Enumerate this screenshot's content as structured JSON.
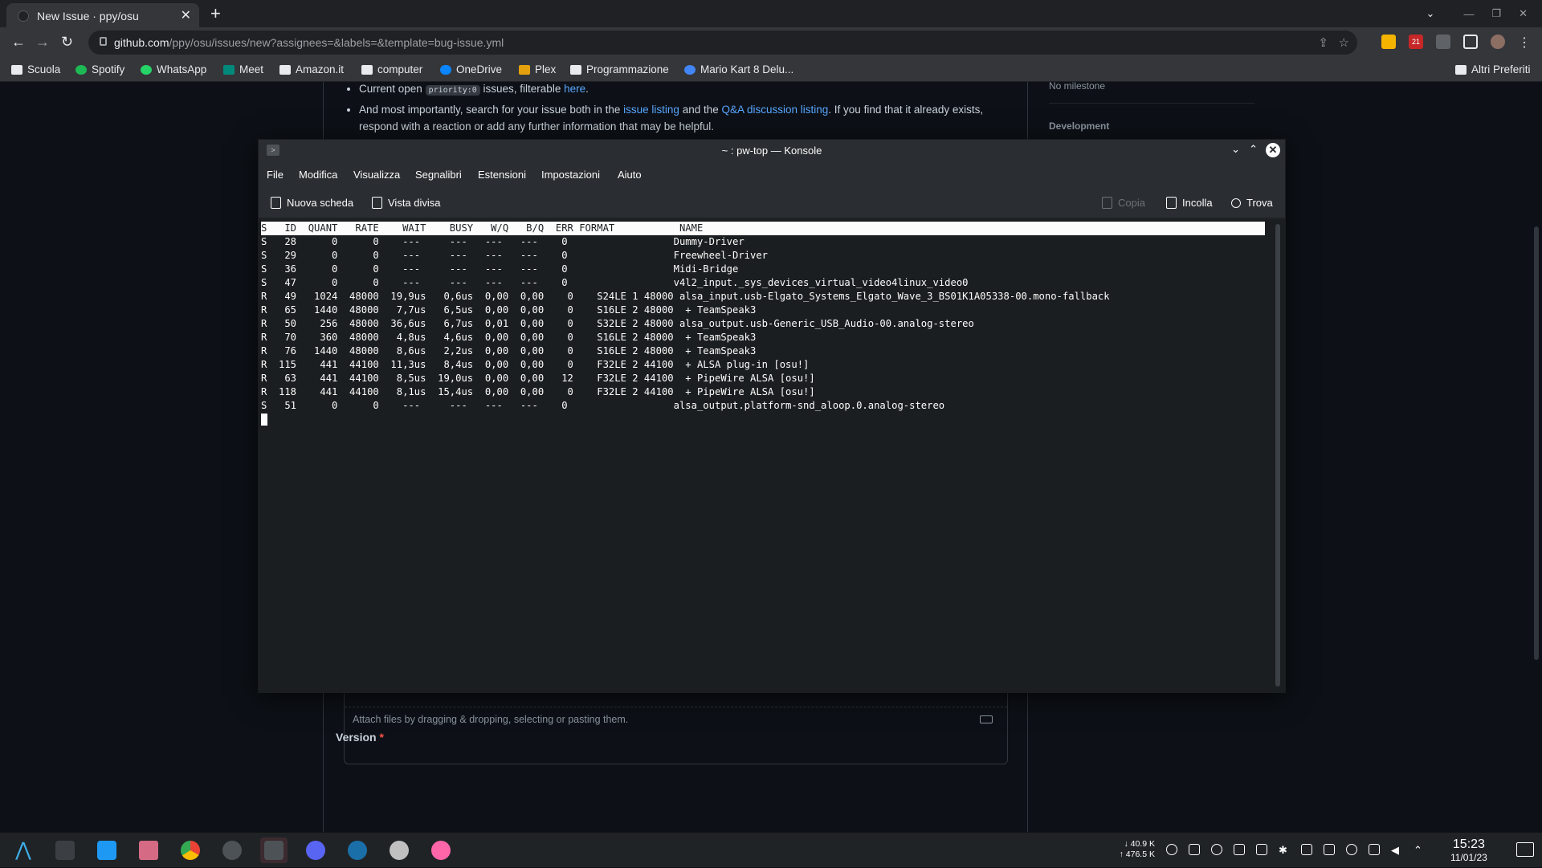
{
  "browser": {
    "tab_title": "New Issue · ppy/osu",
    "tab_close": "✕",
    "new_tab": "+",
    "url_domain": "github.com",
    "url_path": "/ppy/osu/issues/new?assignees=&labels=&template=bug-issue.yml",
    "bookmarks": [
      "Scuola",
      "Spotify",
      "WhatsApp",
      "Meet",
      "Amazon.it",
      "computer",
      "OneDrive",
      "Plex",
      "Programmazione",
      "Mario Kart 8 Delu..."
    ],
    "other_bookmarks": "Altri Preferiti",
    "badge": "21"
  },
  "github": {
    "bullet1_pre": "Current open ",
    "bullet1_code": "priority:0",
    "bullet1_mid": " issues, filterable ",
    "bullet1_link": "here",
    "bullet1_end": ".",
    "bullet2_pre": "And most importantly, search for your issue both in the ",
    "bullet2_link1": "issue listing",
    "bullet2_mid": " and the ",
    "bullet2_link2": "Q&A discussion listing",
    "bullet2_end": ". If you find that it already exists, respond with a reaction or add any further information that may be helpful.",
    "sidebar_milestone": "No milestone",
    "sidebar_development": "Development",
    "attach_hint": "Attach files by dragging & dropping, selecting or pasting them.",
    "version_label": "Version",
    "required_mark": "*"
  },
  "konsole": {
    "title": "~ : pw-top — Konsole",
    "menu": [
      "File",
      "Modifica",
      "Visualizza",
      "Segnalibri",
      "Estensioni",
      "Impostazioni",
      "Aiuto"
    ],
    "tool_new_tab": "Nuova scheda",
    "tool_split": "Vista divisa",
    "tool_copy": "Copia",
    "tool_paste": "Incolla",
    "tool_find": "Trova",
    "terminal_header": "S   ID  QUANT   RATE    WAIT    BUSY   W/Q   B/Q  ERR FORMAT           NAME",
    "terminal_rows": [
      "S   28      0      0    ---     ---   ---   ---    0                  Dummy-Driver",
      "S   29      0      0    ---     ---   ---   ---    0                  Freewheel-Driver",
      "S   36      0      0    ---     ---   ---   ---    0                  Midi-Bridge",
      "S   47      0      0    ---     ---   ---   ---    0                  v4l2_input._sys_devices_virtual_video4linux_video0",
      "R   49   1024  48000  19,9us   0,6us  0,00  0,00    0    S24LE 1 48000 alsa_input.usb-Elgato_Systems_Elgato_Wave_3_BS01K1A05338-00.mono-fallback",
      "R   65   1440  48000   7,7us   6,5us  0,00  0,00    0    S16LE 2 48000  + TeamSpeak3",
      "R   50    256  48000  36,6us   6,7us  0,01  0,00    0    S32LE 2 48000 alsa_output.usb-Generic_USB_Audio-00.analog-stereo",
      "R   70    360  48000   4,8us   4,6us  0,00  0,00    0    S16LE 2 48000  + TeamSpeak3",
      "R   76   1440  48000   8,6us   2,2us  0,00  0,00    0    S16LE 2 48000  + TeamSpeak3",
      "R  115    441  44100  11,3us   8,4us  0,00  0,00    0    F32LE 2 44100  + ALSA plug-in [osu!]",
      "R   63    441  44100   8,5us  19,0us  0,00  0,00   12    F32LE 2 44100  + PipeWire ALSA [osu!]",
      "R  118    441  44100   8,1us  15,4us  0,00  0,00    0    F32LE 2 44100  + PipeWire ALSA [osu!]",
      "S   51      0      0    ---     ---   ---   ---    0                  alsa_output.platform-snd_aloop.0.analog-stereo"
    ]
  },
  "taskbar": {
    "net_down": "↓  40.9 K",
    "net_up": "↑ 476.5 K",
    "time": "15:23",
    "date": "11/01/23"
  }
}
